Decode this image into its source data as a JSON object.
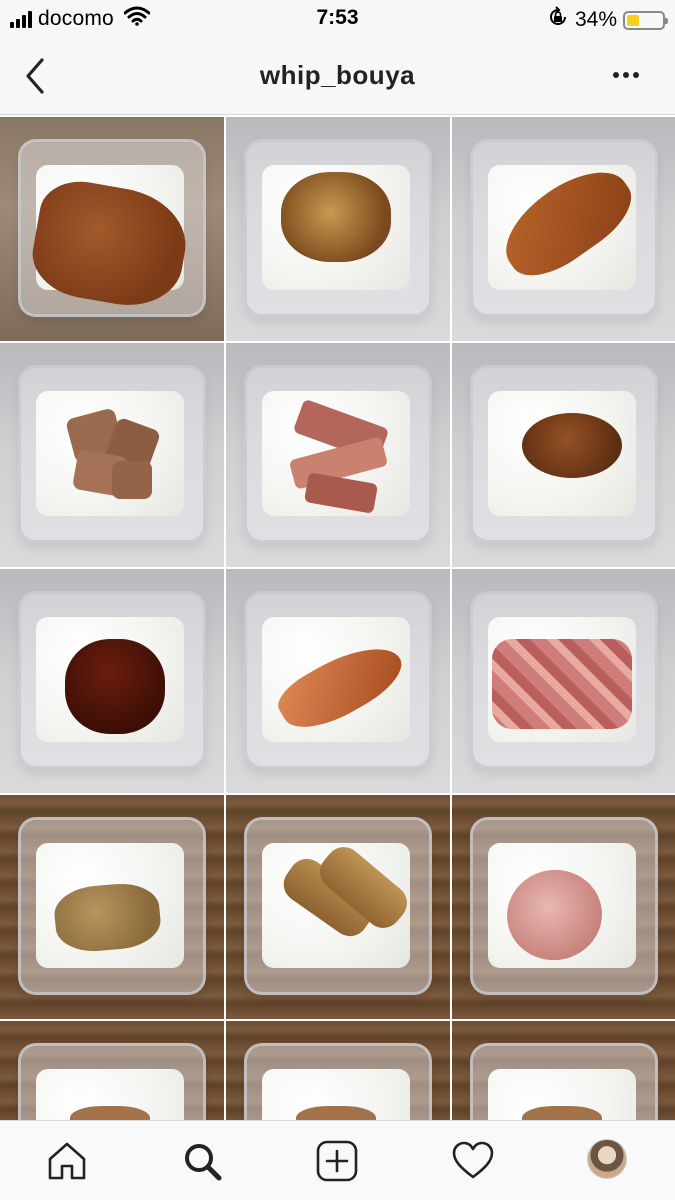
{
  "status_bar": {
    "carrier": "docomo",
    "time": "7:53",
    "battery_percent": "34%",
    "battery_level": 0.34,
    "icons": [
      "signal-icon",
      "wifi-icon",
      "orientation-lock-icon",
      "battery-icon"
    ]
  },
  "header": {
    "title": "whip_bouya",
    "back_icon": "chevron-left-icon",
    "more_icon": "more-horizontal-icon"
  },
  "grid": {
    "columns": 3,
    "posts": [
      {
        "subject": "menchi-katsu",
        "bg": "wood-light"
      },
      {
        "subject": "kakiage",
        "bg": "gray"
      },
      {
        "subject": "fried-fish",
        "bg": "gray"
      },
      {
        "subject": "chashu-pork",
        "bg": "gray"
      },
      {
        "subject": "bacon-strips",
        "bg": "gray"
      },
      {
        "subject": "croquette",
        "bg": "gray"
      },
      {
        "subject": "hamburg-steak",
        "bg": "gray"
      },
      {
        "subject": "grilled-salmon",
        "bg": "gray"
      },
      {
        "subject": "diced-bacon",
        "bg": "gray"
      },
      {
        "subject": "fried-tofu",
        "bg": "wood"
      },
      {
        "subject": "spring-rolls",
        "bg": "wood"
      },
      {
        "subject": "ham-slice",
        "bg": "wood"
      },
      {
        "subject": "partial-dish",
        "bg": "wood"
      },
      {
        "subject": "partial-dish",
        "bg": "wood"
      },
      {
        "subject": "partial-dish",
        "bg": "wood"
      }
    ]
  },
  "tab_bar": {
    "tabs": [
      "home-icon",
      "search-icon",
      "new-post-icon",
      "activity-heart-icon",
      "profile-avatar"
    ],
    "active": "search-icon"
  },
  "colors": {
    "bar_background": "#f7f7f7",
    "icon": "#222222",
    "battery_fill": "#f7cf1e"
  }
}
